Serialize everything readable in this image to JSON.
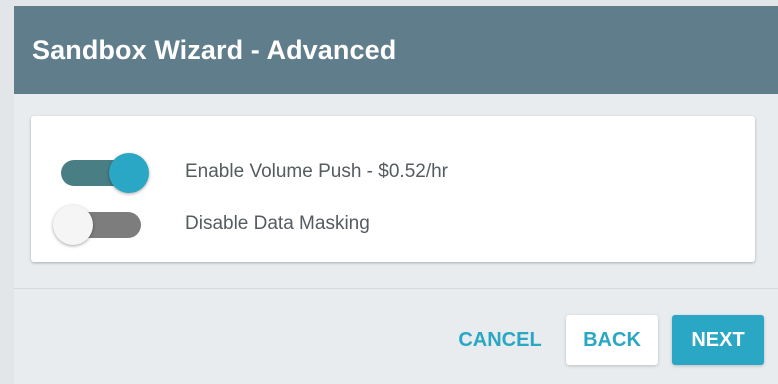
{
  "dialog": {
    "title": "Sandbox Wizard - Advanced"
  },
  "options": [
    {
      "label": "Enable Volume Push - $0.52/hr",
      "checked": true
    },
    {
      "label": "Disable Data Masking",
      "checked": false
    }
  ],
  "footer": {
    "cancel_label": "CANCEL",
    "back_label": "BACK",
    "next_label": "NEXT"
  },
  "colors": {
    "header_bg": "#607d8b",
    "accent": "#2aa7c4",
    "toggle_on_track": "#497e85",
    "toggle_off_track": "#7d7d7d"
  }
}
